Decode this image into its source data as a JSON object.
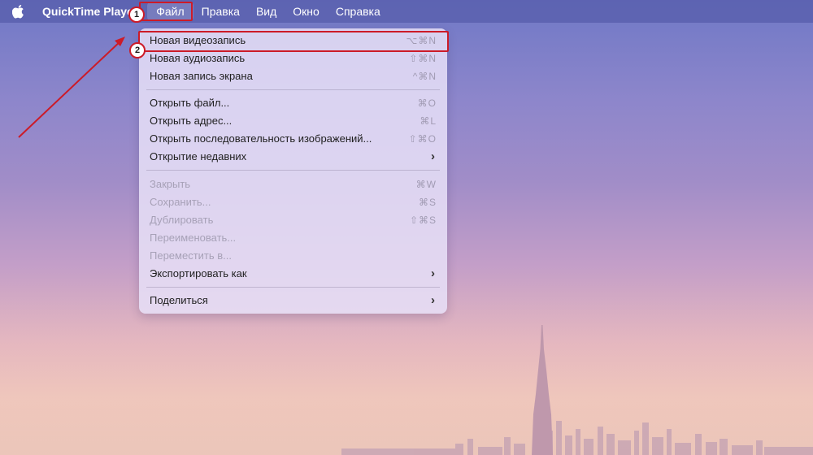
{
  "menubar": {
    "apple_icon": "apple-icon",
    "app_name": "QuickTime Player",
    "items": [
      {
        "label": "Файл"
      },
      {
        "label": "Правка"
      },
      {
        "label": "Вид"
      },
      {
        "label": "Окно"
      },
      {
        "label": "Справка"
      }
    ]
  },
  "file_menu": {
    "groups": [
      [
        {
          "label": "Новая видеозапись",
          "shortcut": "⌥⌘N",
          "enabled": true
        },
        {
          "label": "Новая аудиозапись",
          "shortcut": "⇧⌘N",
          "enabled": true
        },
        {
          "label": "Новая запись экрана",
          "shortcut": "^⌘N",
          "enabled": true
        }
      ],
      [
        {
          "label": "Открыть файл...",
          "shortcut": "⌘O",
          "enabled": true
        },
        {
          "label": "Открыть адрес...",
          "shortcut": "⌘L",
          "enabled": true
        },
        {
          "label": "Открыть последовательность изображений...",
          "shortcut": "⇧⌘O",
          "enabled": true
        },
        {
          "label": "Открытие недавних",
          "shortcut": "",
          "submenu": true,
          "enabled": true
        }
      ],
      [
        {
          "label": "Закрыть",
          "shortcut": "⌘W",
          "enabled": false
        },
        {
          "label": "Сохранить...",
          "shortcut": "⌘S",
          "enabled": false
        },
        {
          "label": "Дублировать",
          "shortcut": "⇧⌘S",
          "enabled": false
        },
        {
          "label": "Переименовать...",
          "shortcut": "",
          "enabled": false
        },
        {
          "label": "Переместить в...",
          "shortcut": "",
          "enabled": false
        },
        {
          "label": "Экспортировать как",
          "shortcut": "",
          "submenu": true,
          "enabled": true
        }
      ],
      [
        {
          "label": "Поделиться",
          "shortcut": "",
          "submenu": true,
          "enabled": true
        }
      ]
    ]
  },
  "annotations": {
    "step1": "1",
    "step2": "2",
    "color": "#cc1b28"
  },
  "colors": {
    "menubar_bg": "#565caa",
    "menu_bg": "#e7e0f7",
    "disabled_text": "#a7a1b7"
  }
}
